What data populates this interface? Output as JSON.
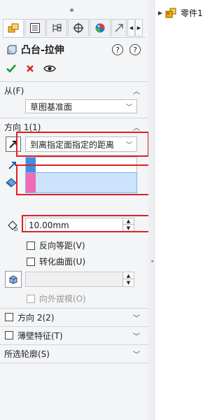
{
  "feature": {
    "title": "凸台-拉伸",
    "help_label": "?"
  },
  "from_section": {
    "label": "从(F)",
    "start_condition": "草图基准面"
  },
  "direction1": {
    "label": "方向 1(1)",
    "end_condition": "到离指定面指定的距离",
    "offset_value": "10.00mm",
    "reverse_offset_label": "反向等距(V)",
    "translate_surface_label": "转化曲面(U)",
    "draft_outward_label": "向外拔模(O)"
  },
  "direction2": {
    "label": "方向 2(2)"
  },
  "thin_feature": {
    "label": "薄壁特征(T)"
  },
  "selected_contours": {
    "label": "所选轮廓(S)"
  },
  "tree": {
    "part_label": "零件1"
  },
  "colors": {
    "blue_selection": "#3b8ee8",
    "pink_selection": "#f06ab5",
    "field_highlight": "#cce4fb",
    "annotation_red": "#e02020"
  }
}
